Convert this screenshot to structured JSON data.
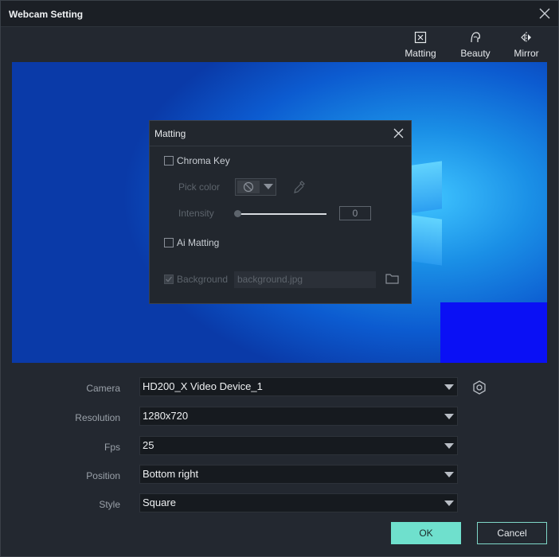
{
  "window": {
    "title": "Webcam Setting"
  },
  "toolbar": {
    "matting_label": "Matting",
    "beauty_label": "Beauty",
    "mirror_label": "Mirror"
  },
  "matting_dialog": {
    "title": "Matting",
    "chroma_key_label": "Chroma Key",
    "pick_color_label": "Pick color",
    "intensity_label": "Intensity",
    "intensity_value": "0",
    "ai_matting_label": "Ai Matting",
    "background_label": "Background",
    "background_placeholder": "background.jpg"
  },
  "form": {
    "camera_label": "Camera",
    "camera_value": "HD200_X Video Device_1",
    "resolution_label": "Resolution",
    "resolution_value": "1280x720",
    "fps_label": "Fps",
    "fps_value": "25",
    "position_label": "Position",
    "position_value": "Bottom right",
    "style_label": "Style",
    "style_value": "Square"
  },
  "buttons": {
    "ok_label": "OK",
    "cancel_label": "Cancel"
  },
  "colors": {
    "accent": "#6fe0cd",
    "pip_color": "#0a10f5",
    "background": "#232830"
  }
}
